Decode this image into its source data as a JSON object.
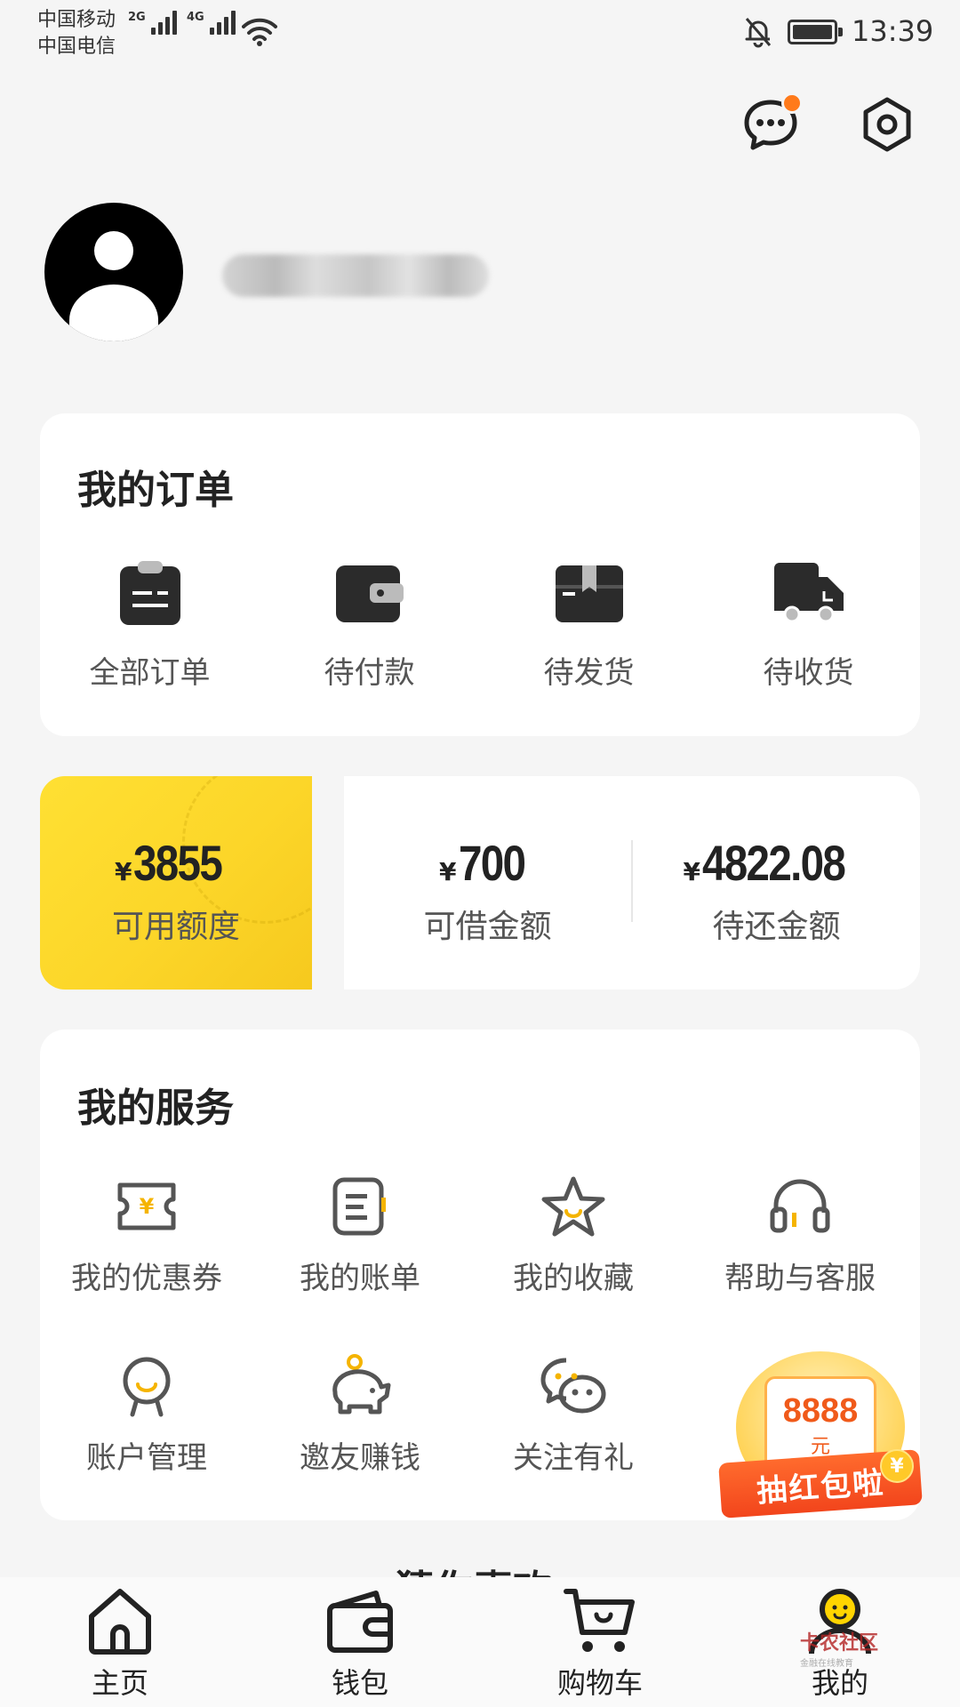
{
  "status_bar": {
    "carrier_1": "中国移动",
    "carrier_2": "中国电信",
    "net_1": "2G",
    "net_2": "4G",
    "time": "13:39"
  },
  "header": {
    "message_icon": "chat-bubble-icon",
    "settings_icon": "hexagon-settings-icon",
    "accent_color": "#ff7a1a"
  },
  "profile": {
    "avatar_icon": "default-avatar-icon"
  },
  "orders": {
    "title": "我的订单",
    "items": [
      {
        "label": "全部订单",
        "icon": "clipboard-icon"
      },
      {
        "label": "待付款",
        "icon": "wallet-icon"
      },
      {
        "label": "待发货",
        "icon": "package-icon"
      },
      {
        "label": "待收货",
        "icon": "truck-icon"
      }
    ]
  },
  "credit": {
    "available": {
      "currency": "¥",
      "value": "3855",
      "label": "可用额度"
    },
    "borrowable": {
      "currency": "¥",
      "value": "700",
      "label": "可借金额"
    },
    "repay": {
      "currency": "¥",
      "value": "4822.08",
      "label": "待还金额"
    },
    "highlight_color": "#fcd629"
  },
  "services": {
    "title": "我的服务",
    "items": [
      {
        "label": "我的优惠券",
        "icon": "coupon-icon"
      },
      {
        "label": "我的账单",
        "icon": "bill-icon"
      },
      {
        "label": "我的收藏",
        "icon": "star-icon"
      },
      {
        "label": "帮助与客服",
        "icon": "headset-icon"
      },
      {
        "label": "账户管理",
        "icon": "account-icon"
      },
      {
        "label": "邀友赚钱",
        "icon": "piggy-bank-icon"
      },
      {
        "label": "关注有礼",
        "icon": "wechat-icon"
      }
    ]
  },
  "promo": {
    "amount": "8888",
    "unit": "元",
    "title": "抽红包啦",
    "coin": "¥"
  },
  "peek_section": {
    "title": "猜你喜欢"
  },
  "tabbar": {
    "items": [
      {
        "label": "主页",
        "icon": "home-icon"
      },
      {
        "label": "钱包",
        "icon": "wallet-icon"
      },
      {
        "label": "购物车",
        "icon": "cart-icon"
      },
      {
        "label": "我的",
        "icon": "profile-icon"
      }
    ]
  },
  "watermark": {
    "main": "卡农社区",
    "sub": "金融在线教育"
  }
}
